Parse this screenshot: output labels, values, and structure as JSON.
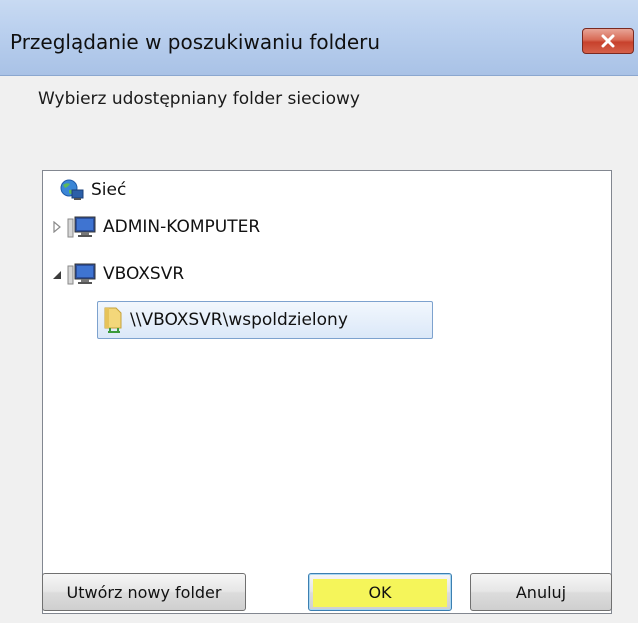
{
  "window": {
    "title": "Przeglądanie w poszukiwaniu folderu",
    "close_symbol": "✕"
  },
  "instruction": "Wybierz udostępniany folder sieciowy",
  "tree": {
    "items": [
      {
        "label": "Sieć",
        "icon": "network-globe-icon",
        "toggle": "none"
      },
      {
        "label": "ADMIN-KOMPUTER",
        "icon": "computer-icon",
        "toggle": "collapsed"
      },
      {
        "label": "VBOXSVR",
        "icon": "computer-icon",
        "toggle": "expanded"
      },
      {
        "label": "\\\\VBOXSVR\\wspoldzielony",
        "icon": "shared-folder-icon",
        "toggle": "none",
        "selected": true
      }
    ]
  },
  "buttons": {
    "new_folder": "Utwórz nowy folder",
    "ok": "OK",
    "cancel": "Anuluj"
  },
  "colors": {
    "titlebar": "#b9cfee",
    "close_button": "#c7412c",
    "selection_border": "#7da2ce",
    "ok_highlight": "#f5f55a"
  }
}
